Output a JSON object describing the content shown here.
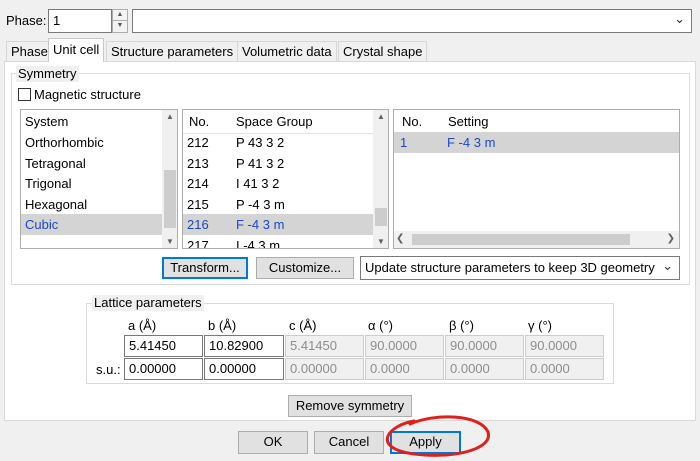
{
  "phase": {
    "label": "Phase:",
    "value": "1",
    "name_value": ""
  },
  "tabs": [
    {
      "label": "Phase",
      "active": false
    },
    {
      "label": "Unit cell",
      "active": true
    },
    {
      "label": "Structure parameters",
      "active": false
    },
    {
      "label": "Volumetric data",
      "active": false
    },
    {
      "label": "Crystal shape",
      "active": false
    }
  ],
  "symmetry": {
    "title": "Symmetry",
    "magnetic_label": "Magnetic structure",
    "magnetic_checked": false,
    "system_list": {
      "items": [
        "System",
        "Orthorhombic",
        "Tetragonal",
        "Trigonal",
        "Hexagonal",
        "Cubic"
      ],
      "selected": "Cubic"
    },
    "space_group_list": {
      "headers": {
        "no": "No.",
        "name": "Space Group"
      },
      "rows": [
        {
          "no": "212",
          "name": "P 43 3 2"
        },
        {
          "no": "213",
          "name": "P 41 3 2"
        },
        {
          "no": "214",
          "name": "I 41 3 2"
        },
        {
          "no": "215",
          "name": "P -4 3 m"
        },
        {
          "no": "216",
          "name": "F -4 3 m"
        },
        {
          "no": "217",
          "name": "I -4 3 m"
        }
      ],
      "selected_no": "216"
    },
    "setting_list": {
      "headers": {
        "no": "No.",
        "setting": "Setting"
      },
      "rows": [
        {
          "no": "1",
          "setting": "F -4 3 m"
        }
      ]
    },
    "transform_button": "Transform...",
    "customize_button": "Customize...",
    "update_mode": "Update structure parameters to keep 3D geometry"
  },
  "lattice": {
    "title": "Lattice parameters",
    "headers": [
      "a (Å)",
      "b (Å)",
      "c (Å)",
      "α (°)",
      "β (°)",
      "γ (°)"
    ],
    "values": [
      "5.41450",
      "10.82900",
      "5.41450",
      "90.0000",
      "90.0000",
      "90.0000"
    ],
    "su_label": "s.u.:",
    "su": [
      "0.00000",
      "0.00000",
      "0.00000",
      "0.0000",
      "0.0000",
      "0.0000"
    ],
    "remove_symmetry_button": "Remove symmetry"
  },
  "footer": {
    "ok": "OK",
    "cancel": "Cancel",
    "apply": "Apply"
  },
  "colors": {
    "selection_text": "#1a48c8",
    "focus_border": "#0078d7",
    "annotation": "#e0201a"
  },
  "icons": {
    "combo_arrow": "chevron-down-icon",
    "spin": "spin-up-down-icon"
  }
}
